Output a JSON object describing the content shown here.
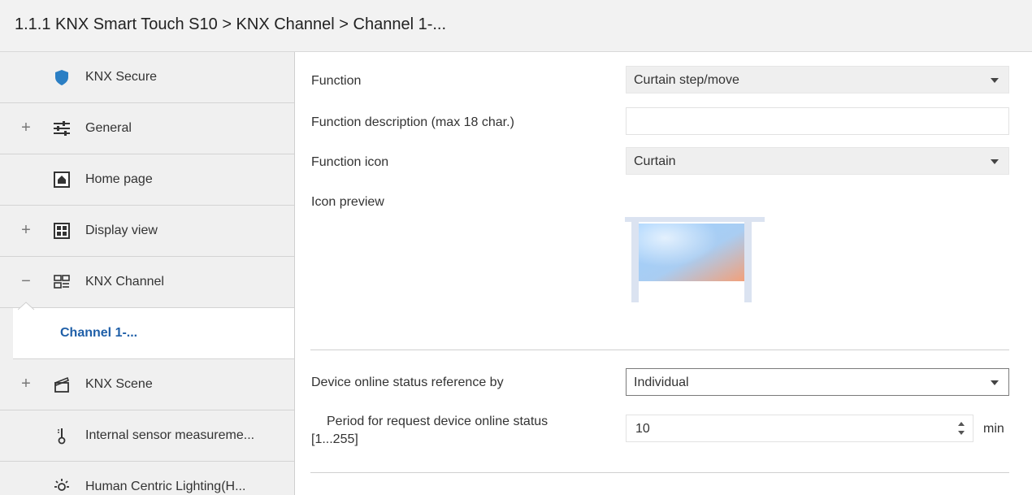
{
  "header": {
    "breadcrumb": "1.1.1 KNX Smart Touch S10 > KNX Channel  > Channel 1-..."
  },
  "sidebar": {
    "items": [
      {
        "label": "KNX Secure",
        "icon": "shield-icon",
        "expander": ""
      },
      {
        "label": "General",
        "icon": "sliders-icon",
        "expander": "+"
      },
      {
        "label": "Home page",
        "icon": "home-icon",
        "expander": ""
      },
      {
        "label": "Display view",
        "icon": "grid-icon",
        "expander": "+"
      },
      {
        "label": "KNX Channel",
        "icon": "channel-icon",
        "expander": "−"
      },
      {
        "label": "Channel 1-...",
        "icon": "",
        "expander": ""
      },
      {
        "label": "KNX Scene",
        "icon": "clapperboard-icon",
        "expander": "+"
      },
      {
        "label": "Internal sensor measureme...",
        "icon": "thermometer-icon",
        "expander": ""
      },
      {
        "label": "Human Centric Lighting(H...",
        "icon": "sun-icon",
        "expander": ""
      }
    ]
  },
  "form": {
    "function_label": "Function",
    "function_value": "Curtain step/move",
    "description_label": "Function description (max 18 char.)",
    "description_value": "",
    "icon_label": "Function icon",
    "icon_value": "Curtain",
    "preview_label": "Icon preview",
    "online_ref_label": "Device online status reference by",
    "online_ref_value": "Individual",
    "period_label_line1": "Period for request device online status",
    "period_label_line2": "[1...255]",
    "period_value": "10",
    "period_unit": "min"
  },
  "colors": {
    "accent": "#1f5fa8",
    "shield": "#2b7fc4",
    "sidebar_bg": "#f0f0f0"
  }
}
